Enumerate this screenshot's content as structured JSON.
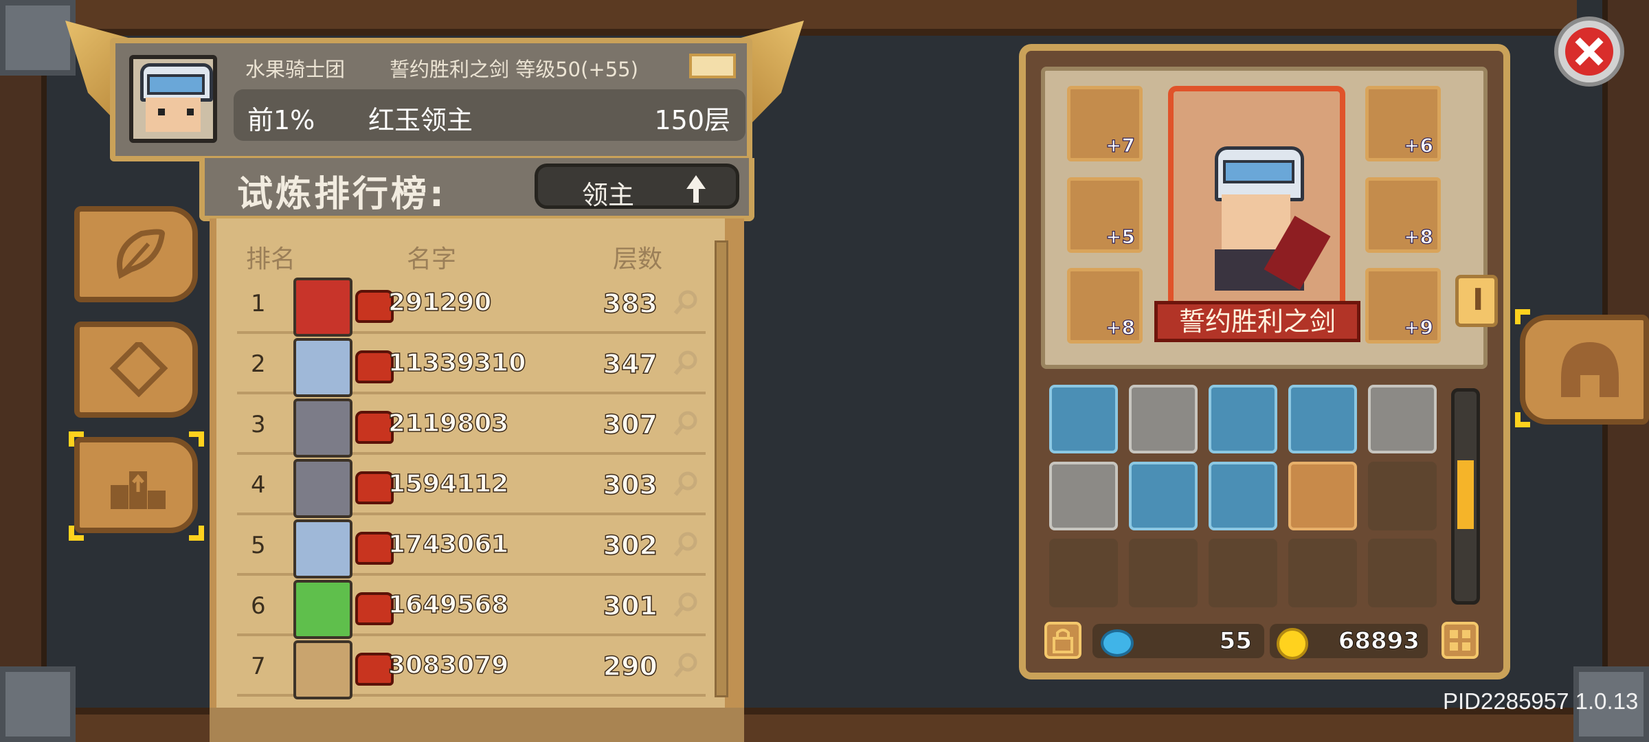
{
  "header": {
    "guild": "水果骑士团",
    "weapon_level": "誓约胜利之剑 等级50(+55)",
    "rank_percent": "前1%",
    "boss_name": "红玉领主",
    "floors": "150层"
  },
  "leaderboard": {
    "title": "试炼排行榜:",
    "mode": "领主",
    "columns": [
      "排名",
      "名字",
      "层数"
    ],
    "rows": [
      {
        "rank": "1",
        "score": "291290",
        "floors": "383"
      },
      {
        "rank": "2",
        "score": "11339310",
        "floors": "347"
      },
      {
        "rank": "3",
        "score": "2119803",
        "floors": "307"
      },
      {
        "rank": "4",
        "score": "1594112",
        "floors": "303"
      },
      {
        "rank": "5",
        "score": "1743061",
        "floors": "302"
      },
      {
        "rank": "6",
        "score": "1649568",
        "floors": "301"
      },
      {
        "rank": "7",
        "score": "3083079",
        "floors": "290"
      }
    ]
  },
  "equipment": {
    "character_name": "誓约胜利之剑",
    "slots": [
      "+7",
      "+5",
      "+8",
      "+6",
      "+8",
      "+9"
    ],
    "tab_marker": "I"
  },
  "currency": {
    "gems": "55",
    "coins": "68893"
  },
  "footer": {
    "pid": "PID2285957 1.0.13"
  },
  "colors": {
    "gold_border": "#caa259",
    "selection": "#ffd21e",
    "close_red": "#d92d2b",
    "inventory_scroll": "#f5b429"
  },
  "icons": [
    "leaf-icon",
    "diamond-icon",
    "podium-icon",
    "ticket-icon",
    "swap-icon",
    "magnifier-icon",
    "lock-icon",
    "gem-icon",
    "coin-icon",
    "grid-icon",
    "close-icon",
    "helmet-icon"
  ]
}
